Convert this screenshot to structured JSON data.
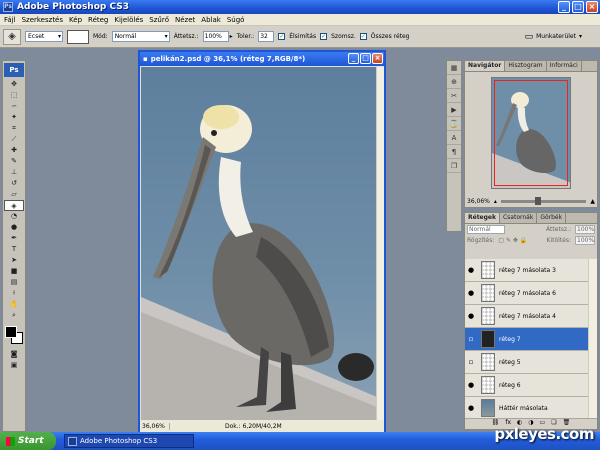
{
  "window": {
    "title": "Adobe Photoshop CS3",
    "app_icon": "Ps"
  },
  "menu": [
    "Fájl",
    "Szerkesztés",
    "Kép",
    "Réteg",
    "Kijelölés",
    "Szűrő",
    "Nézet",
    "Ablak",
    "Súgó"
  ],
  "options": {
    "preset": "Ecset",
    "mode_label": "Mód:",
    "mode_value": "Normál",
    "opacity_label": "Áttetsz.:",
    "opacity_value": "100%",
    "tolerance_label": "Toler.:",
    "tolerance_value": "32",
    "antialias_label": "Élsimítás",
    "contiguous_label": "Szomsz.",
    "all_layers_label": "Összes réteg",
    "workspace_label": "Munkaterület"
  },
  "document": {
    "title": "pelikán2.psd @ 36,1% (réteg 7,RGB/8*)",
    "zoom": "36,06%",
    "doc_size": "Dok.: 6,20M/40,2M"
  },
  "navigator": {
    "tabs": [
      "Navigátor",
      "Hisztogram",
      "Informáci"
    ],
    "zoom": "36,06%"
  },
  "layers_panel": {
    "tabs": [
      "Rétegek",
      "Csatornák",
      "Görbék"
    ],
    "blend_mode": "Normál",
    "opacity_label": "Áttetsz.:",
    "opacity_value": "100%",
    "lock_label": "Rögzítés:",
    "fill_label": "Kitöltés:",
    "fill_value": "100%",
    "layers": [
      {
        "name": "réteg 7 másolata 3",
        "visible": true,
        "selected": false
      },
      {
        "name": "réteg 7 másolata 6",
        "visible": true,
        "selected": false
      },
      {
        "name": "réteg 7 másolata 4",
        "visible": true,
        "selected": false
      },
      {
        "name": "réteg 7",
        "visible": false,
        "selected": true
      },
      {
        "name": "réteg 5",
        "visible": false,
        "selected": false
      },
      {
        "name": "réteg 6",
        "visible": true,
        "selected": false
      },
      {
        "name": "Háttér másolata",
        "visible": true,
        "selected": false
      }
    ]
  },
  "taskbar": {
    "start_label": "Start",
    "task_label": "Adobe Photoshop CS3"
  },
  "watermark": "pxleyes.com"
}
